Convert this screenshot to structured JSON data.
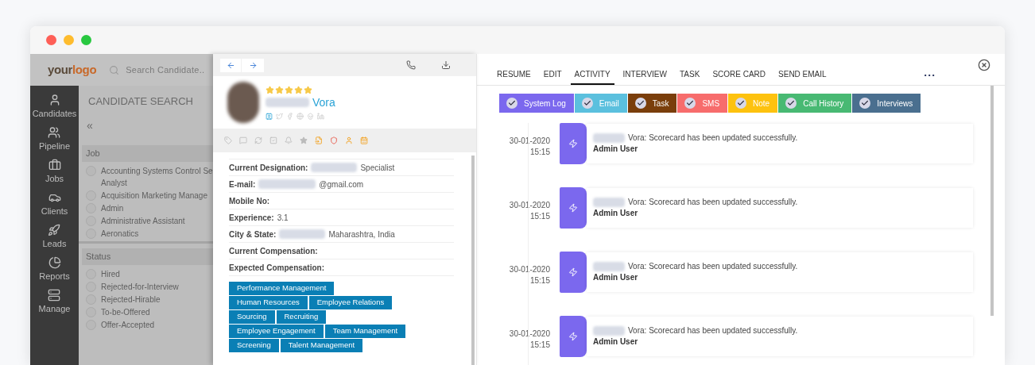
{
  "logo": {
    "part_1": "your",
    "part_2": "logo"
  },
  "search": {
    "placeholder": "Search Candidate.."
  },
  "nav": [
    {
      "label": "Candidates"
    },
    {
      "label": "Pipeline"
    },
    {
      "label": "Jobs"
    },
    {
      "label": "Clients"
    },
    {
      "label": "Leads"
    },
    {
      "label": "Reports"
    },
    {
      "label": "Manage"
    }
  ],
  "candidate_search": {
    "title": "CANDIDATE SEARCH",
    "collapse": "«",
    "groups": [
      {
        "title": "Job",
        "options": [
          {
            "label": "Accounting Systems Control Se Analyst",
            "selected": false
          },
          {
            "label": "Acquisition Marketing Manage",
            "selected": false
          },
          {
            "label": "Admin",
            "selected": false
          },
          {
            "label": "Administrative Assistant",
            "selected": false
          },
          {
            "label": "Aeronatics",
            "selected": false
          }
        ]
      },
      {
        "title": "Status",
        "options": [
          {
            "label": "Hired",
            "selected": false
          },
          {
            "label": "Rejected-for-Interview",
            "selected": false
          },
          {
            "label": "Rejected-Hirable",
            "selected": false
          },
          {
            "label": "To-be-Offered",
            "selected": false
          },
          {
            "label": "Offer-Accepted",
            "selected": false
          }
        ]
      }
    ]
  },
  "profile": {
    "stars": 5,
    "last_name": "Vora",
    "fields": [
      {
        "label": "Current Designation:",
        "value": "Specialist",
        "redacted": true
      },
      {
        "label": "E-mail:",
        "value": "@gmail.com",
        "redacted": true
      },
      {
        "label": "Mobile No:",
        "redacted": false
      },
      {
        "label": "Experience:",
        "value": "3.1",
        "redacted": false
      },
      {
        "label": "City & State:",
        "value": "Maharashtra, India",
        "redacted": true
      },
      {
        "label": "Current Compensation:",
        "redacted": false
      },
      {
        "label": "Expected Compensation:",
        "redacted": false
      }
    ],
    "skills": [
      [
        "Performance Management"
      ],
      [
        "Human Resources",
        "Employee Relations"
      ],
      [
        "Sourcing",
        "Recruiting"
      ],
      [
        "Employee Engagement",
        "Team Management"
      ],
      [
        "Screening",
        "Talent Management"
      ]
    ]
  },
  "tabs": [
    {
      "label": "RESUME",
      "selected": false
    },
    {
      "label": "EDIT",
      "selected": false
    },
    {
      "label": "ACTIVITY",
      "selected": true
    },
    {
      "label": "INTERVIEW",
      "selected": false
    },
    {
      "label": "TASK",
      "selected": false
    },
    {
      "label": "SCORE CARD",
      "selected": false
    },
    {
      "label": "SEND EMAIL",
      "selected": false
    }
  ],
  "more": "• • •",
  "filters": [
    {
      "label": "System Log",
      "color": "#7b68ee",
      "checked": true
    },
    {
      "label": "Email",
      "color": "#5bc0de",
      "checked": true
    },
    {
      "label": "Task",
      "color": "#7a3e0b",
      "checked": true
    },
    {
      "label": "SMS",
      "color": "#f76c6c",
      "checked": true
    },
    {
      "label": "Note",
      "color": "#fdc20f",
      "checked": true
    },
    {
      "label": "Call History",
      "color": "#48b973",
      "checked": true
    },
    {
      "label": "Interviews",
      "color": "#4a6f8f",
      "checked": true
    }
  ],
  "activities": [
    {
      "date": "30-01-2020",
      "time": "15:15",
      "message": "Vora: Scorecard has been updated successfully.",
      "user": "Admin User"
    },
    {
      "date": "30-01-2020",
      "time": "15:15",
      "message": "Vora: Scorecard has been updated successfully.",
      "user": "Admin User"
    },
    {
      "date": "30-01-2020",
      "time": "15:15",
      "message": "Vora: Scorecard has been updated successfully.",
      "user": "Admin User"
    },
    {
      "date": "30-01-2020",
      "time": "15:15",
      "message": "Vora: Scorecard has been updated successfully.",
      "user": "Admin User"
    }
  ]
}
